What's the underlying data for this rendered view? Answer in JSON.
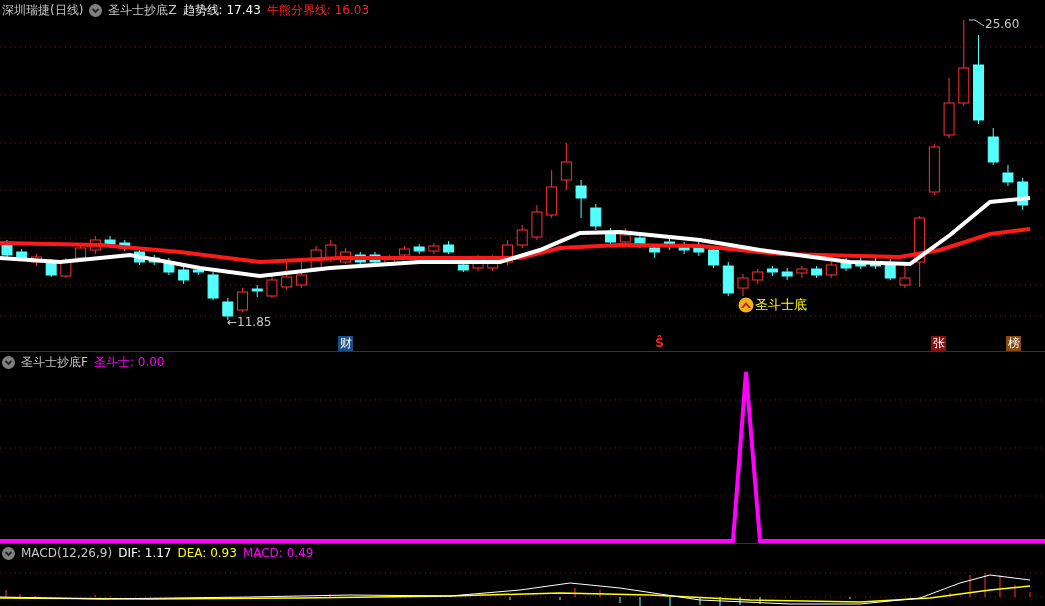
{
  "main_panel": {
    "stock_name": "深圳瑞捷(日线)",
    "indicator": "圣斗士抄底Z",
    "legend": [
      {
        "text": "趋势线: 17.43",
        "color": "#ffffff"
      },
      {
        "text": "牛熊分界线: 16.03",
        "color": "#ff2020"
      }
    ],
    "high_label": "25.60",
    "low_label": "←11.85",
    "signal_label": "圣斗士底",
    "event_tags": [
      {
        "kind": "box",
        "text": "财",
        "color": "#1d4f86"
      },
      {
        "kind": "plain",
        "text": "Ŝ",
        "color": "#ff2020"
      },
      {
        "kind": "box",
        "text": "张",
        "color": "#8a1010"
      },
      {
        "kind": "box",
        "text": "榜",
        "color": "#8a4a10"
      }
    ]
  },
  "signal_panel": {
    "indicator": "圣斗士抄底F",
    "legend": [
      {
        "text": "圣斗士: 0.00",
        "color": "#ff00ff"
      }
    ]
  },
  "macd_panel": {
    "indicator": "MACD(12,26,9)",
    "legend": [
      {
        "text": "DIF: 1.17",
        "color": "#ffffff"
      },
      {
        "text": "DEA: 0.93",
        "color": "#ffff00"
      },
      {
        "text": "MACD: 0.49",
        "color": "#ff00ff"
      }
    ]
  }
}
